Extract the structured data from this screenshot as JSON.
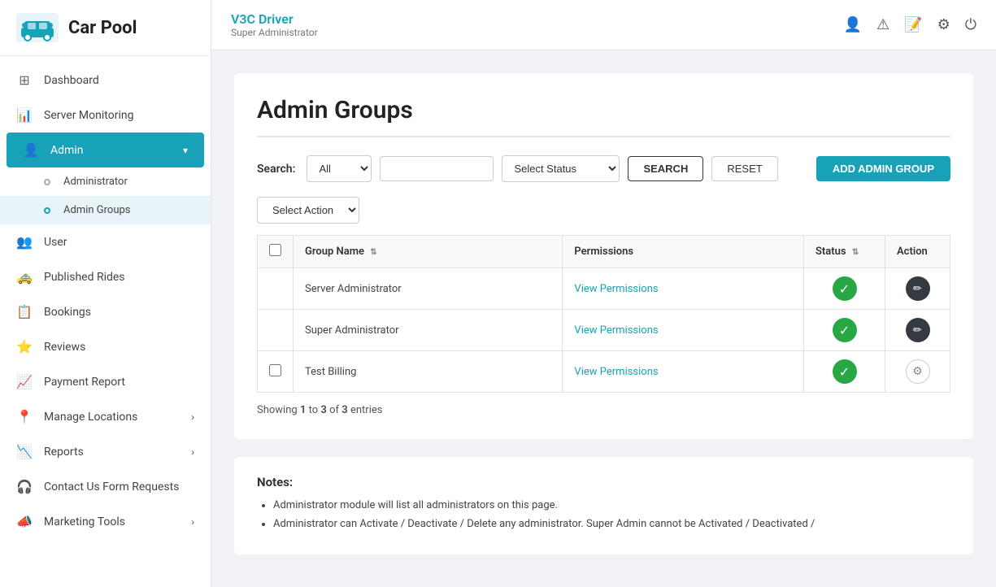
{
  "sidebar": {
    "logo_text": "Car Pool",
    "items": [
      {
        "id": "dashboard",
        "label": "Dashboard",
        "icon": "⊞",
        "active": false,
        "hasArrow": false
      },
      {
        "id": "server-monitoring",
        "label": "Server Monitoring",
        "icon": "📊",
        "active": false,
        "hasArrow": false
      },
      {
        "id": "admin",
        "label": "Admin",
        "icon": "👤",
        "active": true,
        "hasArrow": true
      },
      {
        "id": "user",
        "label": "User",
        "icon": "👥",
        "active": false,
        "hasArrow": false
      },
      {
        "id": "published-rides",
        "label": "Published Rides",
        "icon": "🚕",
        "active": false,
        "hasArrow": false
      },
      {
        "id": "bookings",
        "label": "Bookings",
        "icon": "📋",
        "active": false,
        "hasArrow": false
      },
      {
        "id": "reviews",
        "label": "Reviews",
        "icon": "⭐",
        "active": false,
        "hasArrow": false
      },
      {
        "id": "payment-report",
        "label": "Payment Report",
        "icon": "📈",
        "active": false,
        "hasArrow": false
      },
      {
        "id": "manage-locations",
        "label": "Manage Locations",
        "icon": "📍",
        "active": false,
        "hasArrow": true
      },
      {
        "id": "reports",
        "label": "Reports",
        "icon": "📉",
        "active": false,
        "hasArrow": true
      },
      {
        "id": "contact-us",
        "label": "Contact Us Form Requests",
        "icon": "🎧",
        "active": false,
        "hasArrow": false
      },
      {
        "id": "marketing-tools",
        "label": "Marketing Tools",
        "icon": "📣",
        "active": false,
        "hasArrow": true
      }
    ],
    "sub_items": [
      {
        "id": "administrator",
        "label": "Administrator",
        "active": false
      },
      {
        "id": "admin-groups",
        "label": "Admin Groups",
        "active": true
      }
    ]
  },
  "header": {
    "app_name": "V3C Driver",
    "role": "Super Administrator",
    "icons": [
      "user-icon",
      "warning-icon",
      "edit-icon",
      "settings-icon",
      "power-icon"
    ]
  },
  "page": {
    "title": "Admin Groups",
    "search": {
      "label": "Search:",
      "filter_option": "All",
      "placeholder": "",
      "status_placeholder": "Select Status",
      "btn_search": "SEARCH",
      "btn_reset": "RESET",
      "btn_add": "ADD ADMIN GROUP"
    },
    "action_select_placeholder": "Select Action",
    "table": {
      "columns": [
        "",
        "Group Name",
        "Permissions",
        "Status",
        "Action"
      ],
      "rows": [
        {
          "id": 1,
          "name": "Server Administrator",
          "permissions_label": "View Permissions",
          "status": "active",
          "hasCheckbox": false
        },
        {
          "id": 2,
          "name": "Super Administrator",
          "permissions_label": "View Permissions",
          "status": "active",
          "hasCheckbox": false
        },
        {
          "id": 3,
          "name": "Test Billing",
          "permissions_label": "View Permissions",
          "status": "active",
          "hasCheckbox": true
        }
      ]
    },
    "showing": {
      "text_prefix": "Showing",
      "from": "1",
      "to": "3",
      "total": "3",
      "text_suffix": "entries"
    },
    "notes": {
      "title": "Notes:",
      "items": [
        "Administrator module will list all administrators on this page.",
        "Administrator can Activate / Deactivate / Delete any administrator. Super Admin cannot be Activated / Deactivated /"
      ]
    }
  }
}
